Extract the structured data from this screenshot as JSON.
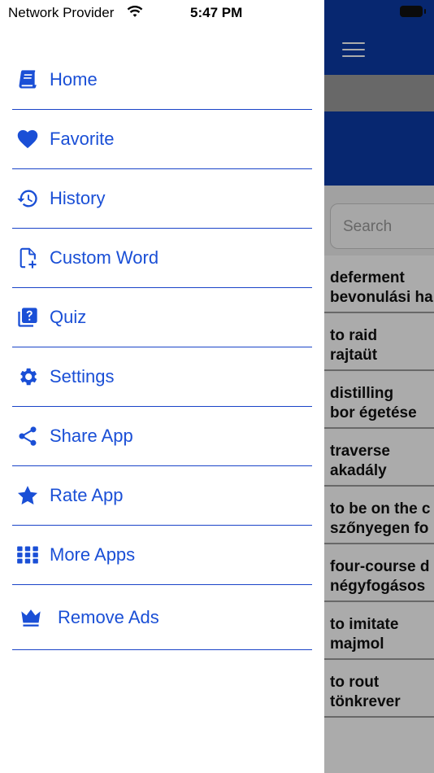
{
  "status_bar": {
    "carrier": "Network Provider",
    "time": "5:47 PM"
  },
  "drawer": {
    "items": [
      {
        "label": "Home",
        "icon": "book-icon"
      },
      {
        "label": "Favorite",
        "icon": "heart-icon"
      },
      {
        "label": "History",
        "icon": "history-icon"
      },
      {
        "label": "Custom Word",
        "icon": "file-add-icon"
      },
      {
        "label": "Quiz",
        "icon": "quiz-icon"
      },
      {
        "label": "Settings",
        "icon": "gear-icon"
      },
      {
        "label": "Share App",
        "icon": "share-icon"
      },
      {
        "label": "Rate App",
        "icon": "star-icon"
      },
      {
        "label": "More Apps",
        "icon": "grid-icon"
      },
      {
        "label": "Remove Ads",
        "icon": "crown-icon"
      }
    ]
  },
  "background_app": {
    "search_placeholder": "Search",
    "words": [
      {
        "en": "deferment",
        "hu": "bevonulási ha"
      },
      {
        "en": "to raid",
        "hu": "rajtaüt"
      },
      {
        "en": "distilling",
        "hu": "bor égetése"
      },
      {
        "en": "traverse",
        "hu": "akadály"
      },
      {
        "en": "to be on the c",
        "hu": "szőnyegen fo"
      },
      {
        "en": "four-course d",
        "hu": "négyfogásos"
      },
      {
        "en": "to imitate",
        "hu": "majmol"
      },
      {
        "en": "to rout",
        "hu": "tönkrever"
      }
    ]
  },
  "colors": {
    "accent": "#1a4fd6",
    "app_bar": "#0b3ba8",
    "divider": "#1a44c8"
  }
}
